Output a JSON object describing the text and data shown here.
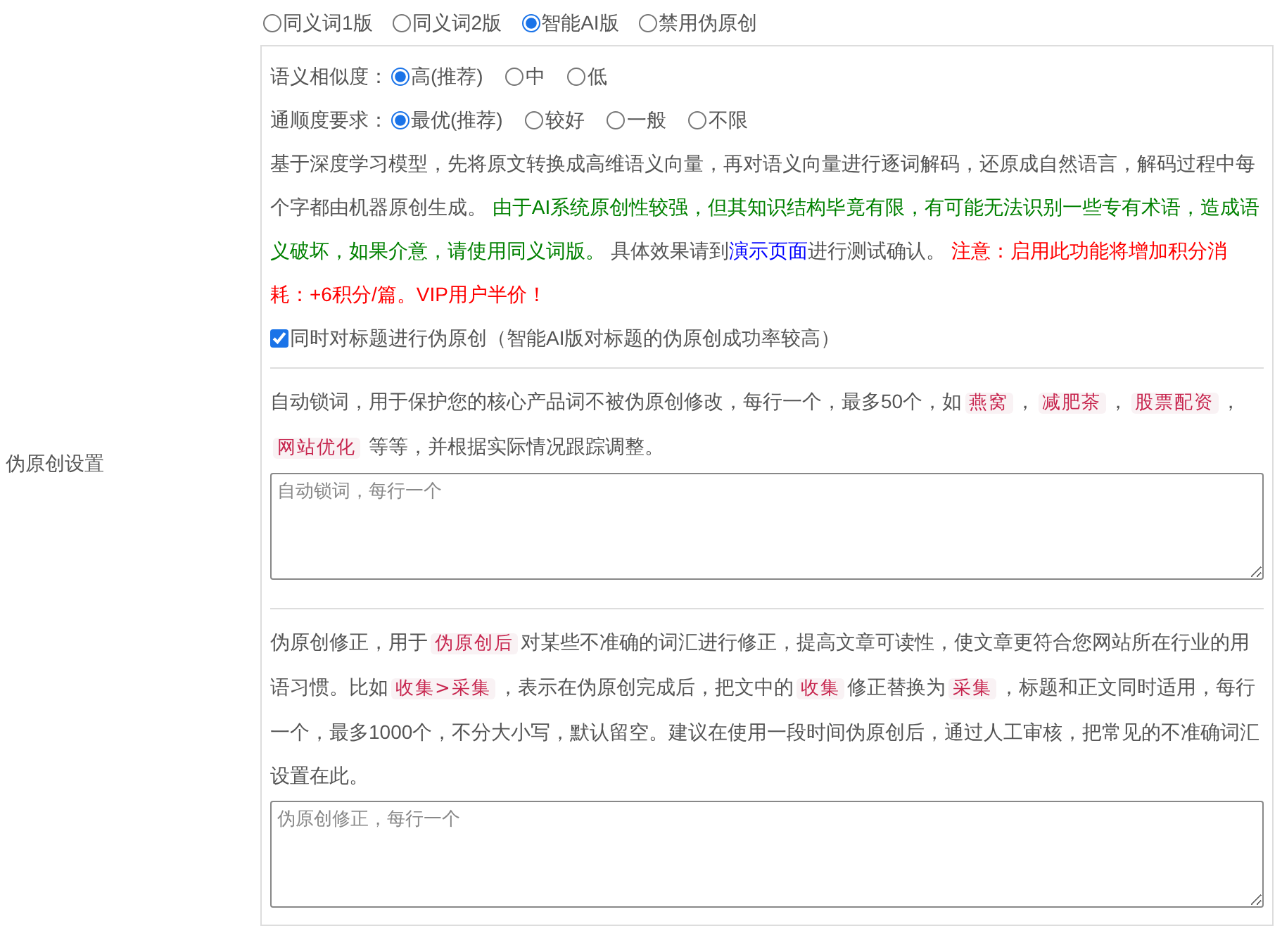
{
  "section_label": "伪原创设置",
  "modes": [
    {
      "label": "同义词1版",
      "selected": false
    },
    {
      "label": "同义词2版",
      "selected": false
    },
    {
      "label": "智能AI版",
      "selected": true
    },
    {
      "label": "禁用伪原创",
      "selected": false
    }
  ],
  "settings": [
    {
      "label": "语义相似度：",
      "options": [
        {
          "label": "高(推荐)",
          "selected": true
        },
        {
          "label": "中",
          "selected": false
        },
        {
          "label": "低",
          "selected": false
        }
      ]
    },
    {
      "label": "通顺度要求：",
      "options": [
        {
          "label": "最优(推荐)",
          "selected": true
        },
        {
          "label": "较好",
          "selected": false
        },
        {
          "label": "一般",
          "selected": false
        },
        {
          "label": "不限",
          "selected": false
        }
      ]
    }
  ],
  "description": [
    {
      "kind": "plain",
      "text": "基于深度学习模型，先将原文转换成高维语义向量，再对语义向量进行逐词解码，还原成自然语言，解码过程中每个字都由机器原创生成。 "
    },
    {
      "kind": "green",
      "text": "由于AI系统原创性较强，但其知识结构毕竟有限，有可能无法识别一些专有术语，造成语义破坏，如果介意，请使用同义词版。"
    },
    {
      "kind": "plain",
      "text": " 具体效果请到"
    },
    {
      "kind": "link",
      "text": "演示页面"
    },
    {
      "kind": "plain",
      "text": "进行测试确认。 "
    },
    {
      "kind": "red",
      "text": "注意：启用此功能将增加积分消耗：+6积分/篇。VIP用户半价！"
    }
  ],
  "title_option": {
    "label": "同时对标题进行伪原创（智能AI版对标题的伪原创成功率较高）",
    "checked": true
  },
  "lock_words": {
    "description": [
      {
        "kind": "plain",
        "text": "自动锁词，用于保护您的核心产品词不被伪原创修改，每行一个，最多50个，如"
      },
      {
        "kind": "tag",
        "text": "燕窝"
      },
      {
        "kind": "plain",
        "text": "，"
      },
      {
        "kind": "tag",
        "text": "减肥茶"
      },
      {
        "kind": "plain",
        "text": "，"
      },
      {
        "kind": "tag",
        "text": "股票配资"
      },
      {
        "kind": "plain",
        "text": "，"
      },
      {
        "kind": "tag",
        "text": "网站优化"
      },
      {
        "kind": "plain",
        "text": " 等等，并根据实际情况跟踪调整。"
      }
    ],
    "placeholder": "自动锁词，每行一个"
  },
  "corrections": {
    "description": [
      {
        "kind": "plain",
        "text": "伪原创修正，用于"
      },
      {
        "kind": "tag",
        "text": "伪原创后"
      },
      {
        "kind": "plain",
        "text": "对某些不准确的词汇进行修正，提高文章可读性，使文章更符合您网站所在行业的用语习惯。比如"
      },
      {
        "kind": "tag",
        "text": "收集>采集"
      },
      {
        "kind": "plain",
        "text": "，表示在伪原创完成后，把文中的"
      },
      {
        "kind": "tag",
        "text": "收集"
      },
      {
        "kind": "plain",
        "text": "修正替换为"
      },
      {
        "kind": "tag",
        "text": "采集"
      },
      {
        "kind": "plain",
        "text": "，标题和正文同时适用，每行一个，最多1000个，不分大小写，默认留空。建议在使用一段时间伪原创后，通过人工审核，把常见的不准确词汇设置在此。"
      }
    ],
    "placeholder": "伪原创修正，每行一个"
  }
}
